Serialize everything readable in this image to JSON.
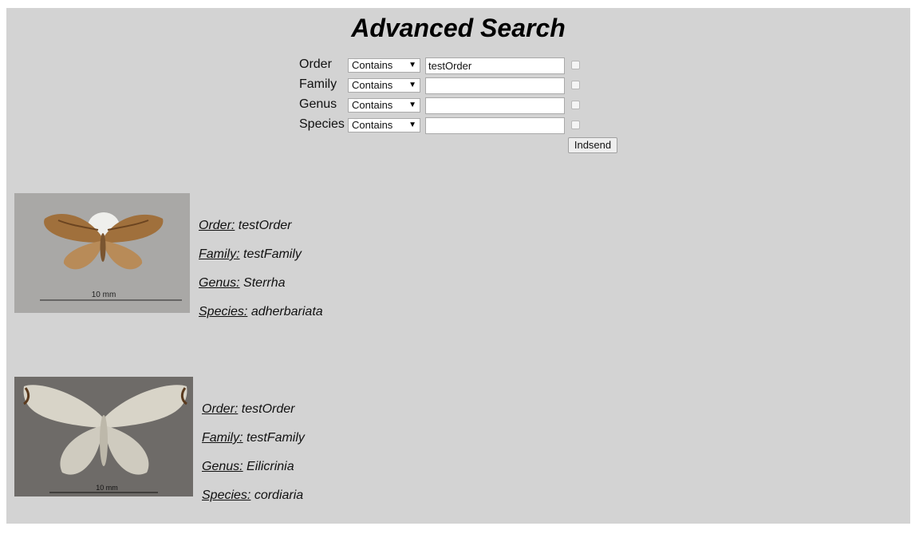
{
  "page": {
    "title": "Advanced Search"
  },
  "search": {
    "rows": [
      {
        "label": "Order",
        "operator": "Contains",
        "value": "testOrder"
      },
      {
        "label": "Family",
        "operator": "Contains",
        "value": ""
      },
      {
        "label": "Genus",
        "operator": "Contains",
        "value": ""
      },
      {
        "label": "Species",
        "operator": "Contains",
        "value": ""
      }
    ],
    "submit_label": "Indsend"
  },
  "results": [
    {
      "scale_label": "10 mm",
      "fields": [
        {
          "key": "Order:",
          "value": "testOrder"
        },
        {
          "key": "Family:",
          "value": "testFamily"
        },
        {
          "key": "Genus:",
          "value": "Sterrha"
        },
        {
          "key": "Species:",
          "value": "adherbariata"
        }
      ]
    },
    {
      "scale_label": "10 mm",
      "fields": [
        {
          "key": "Order:",
          "value": "testOrder"
        },
        {
          "key": "Family:",
          "value": "testFamily"
        },
        {
          "key": "Genus:",
          "value": "Eilicrinia"
        },
        {
          "key": "Species:",
          "value": "cordiaria"
        }
      ]
    }
  ]
}
